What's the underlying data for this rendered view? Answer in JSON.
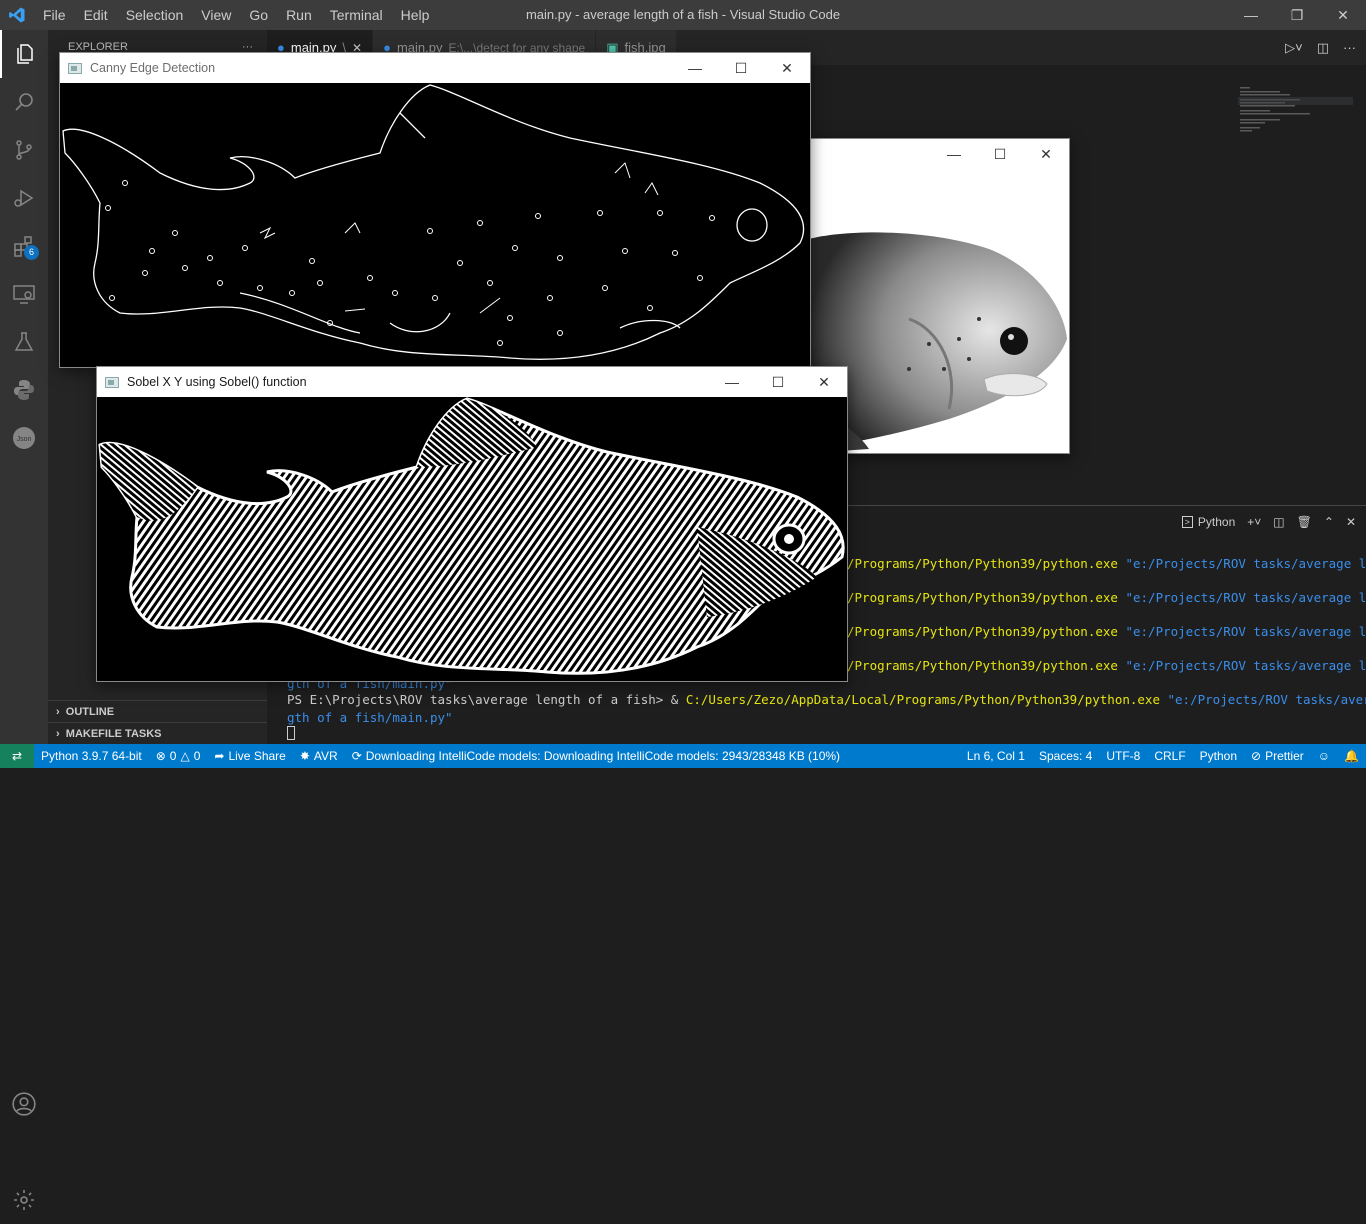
{
  "window": {
    "title": "main.py - average length of a fish - Visual Studio Code",
    "menu": [
      "File",
      "Edit",
      "Selection",
      "View",
      "Go",
      "Run",
      "Terminal",
      "Help"
    ]
  },
  "activity_bar": {
    "extensions_badge": "6"
  },
  "sidebar": {
    "header": "EXPLORER",
    "header_more": "···",
    "outline": "OUTLINE",
    "makefile_tasks": "MAKEFILE TASKS"
  },
  "tabs": [
    {
      "label": "main.py",
      "suffix": "\\",
      "close": "✕"
    },
    {
      "label": "main.py",
      "path": "E:\\...\\detect for any shape"
    },
    {
      "label": "fish.jpg"
    }
  ],
  "panel": {
    "terminal_shell": "Python",
    "lines": [
      {
        "pre": "",
        "yellow": "/Programs/Python/Python39/python.exe",
        "blue": " \"e:/Projects/ROV tasks/average len"
      },
      {
        "pre": "",
        "yellow": "/Programs/Python/Python39/python.exe",
        "blue": " \"e:/Projects/ROV tasks/average len"
      },
      {
        "pre": "",
        "yellow": "/Programs/Python/Python39/python.exe",
        "blue": " \"e:/Projects/ROV tasks/average len"
      },
      {
        "pre": "",
        "yellow": "/Programs/Python/Python39/python.exe",
        "blue": " \"e:/Projects/ROV tasks/average len"
      }
    ],
    "wrap1": "gth of a fish/main.py\"",
    "prompt": "PS E:\\Projects\\ROV tasks\\average length of a fish> & ",
    "prompt_cmd": "C:/Users/Zezo/AppData/Local/Programs/Python/Python39/python.exe",
    "prompt_arg": " \"e:/Projects/ROV tasks/average len",
    "wrap2": "gth of a fish/main.py\""
  },
  "cv_windows": {
    "canny": {
      "title": "Canny Edge Detection"
    },
    "sobel": {
      "title": "Sobel X Y using Sobel() function"
    },
    "original": {
      "title": ""
    }
  },
  "status": {
    "python": "Python 3.9.7 64-bit",
    "errors": "0",
    "warnings": "0",
    "live_share": "Live Share",
    "avr": "AVR",
    "intellicode": "Downloading IntelliCode models: Downloading IntelliCode models: 2943/28348 KB (10%)",
    "position": "Ln 6, Col 1",
    "spaces": "Spaces: 4",
    "encoding": "UTF-8",
    "eol": "CRLF",
    "language": "Python",
    "prettier": "Prettier"
  },
  "colors": {
    "statusbar": "#007acc",
    "terminal_yellow": "#e5e510",
    "terminal_blue": "#3b8eea"
  }
}
